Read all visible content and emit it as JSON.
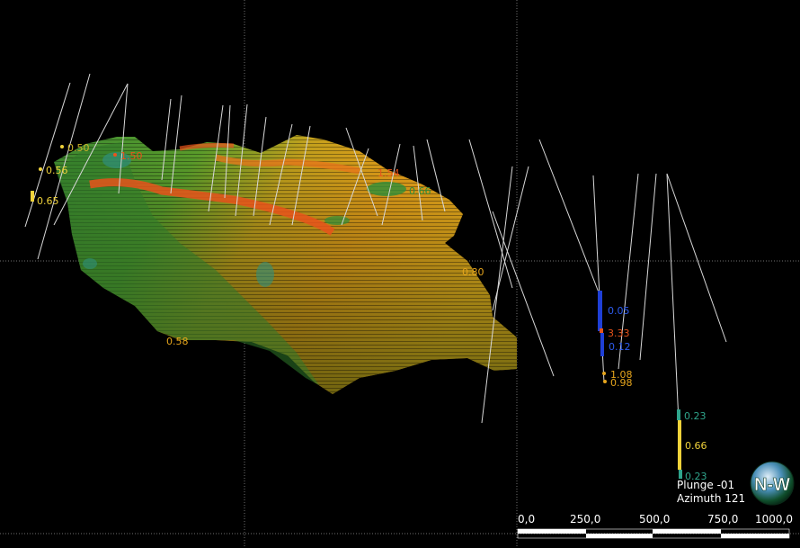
{
  "viewer": {
    "plunge_label": "Plunge -01",
    "azimuth_label": "Azimuth 121"
  },
  "scale_bar": {
    "ticks": [
      "0,0",
      "250,0",
      "500,0",
      "750,0",
      "1000,0"
    ]
  },
  "compass": {
    "letters": "N-W",
    "icon": "compass-globe-icon"
  },
  "grade_labels": {
    "left": [
      "0.50",
      "0.56",
      "0.65",
      "1.50"
    ],
    "top": [
      "1.54",
      "0.66",
      "0.80",
      "0.58"
    ],
    "hole_a": [
      "0.05",
      "3.33",
      "0.12",
      "1.08",
      "0.98"
    ],
    "hole_b": [
      "0.23",
      "0.66",
      "0.23"
    ]
  },
  "colors": {
    "background": "#000000",
    "grid": "#7a7a7a",
    "drill_trace": "#d8d8d8",
    "low_grade": "#2e8f3a",
    "mid_grade": "#e6a51c",
    "high_grade": "#e8541b",
    "blue_interval": "#1f3fd6",
    "teal_interval": "#2fa58c",
    "yellow_interval": "#f0d23a"
  }
}
